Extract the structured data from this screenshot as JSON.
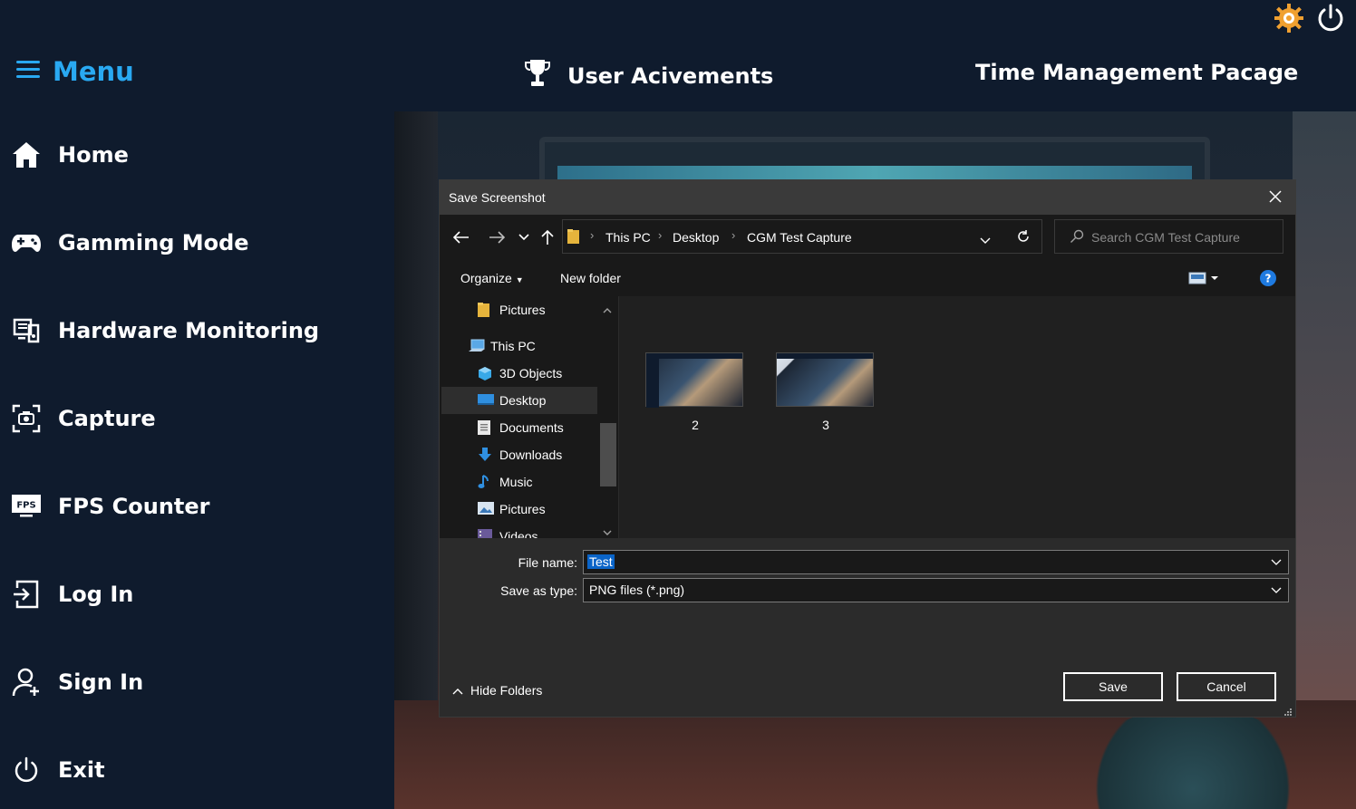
{
  "header": {
    "menu_label": "Menu",
    "achievements_label": "User Acivements",
    "time_label": "Time Management Pacage",
    "settings_icon": "gear-icon",
    "power_icon": "power-icon",
    "accent_color": "#29a9f2"
  },
  "sidebar": {
    "items": [
      {
        "label": "Home",
        "icon": "home-icon"
      },
      {
        "label": "Gamming Mode",
        "icon": "gamepad-icon"
      },
      {
        "label": "Hardware Monitoring",
        "icon": "hardware-monitor-icon"
      },
      {
        "label": "Capture",
        "icon": "capture-camera-icon"
      },
      {
        "label": "FPS Counter",
        "icon": "fps-icon"
      },
      {
        "label": "Log In",
        "icon": "login-icon"
      },
      {
        "label": "Sign In",
        "icon": "user-add-icon"
      },
      {
        "label": "Exit",
        "icon": "power-icon"
      }
    ]
  },
  "dialog": {
    "title": "Save Screenshot",
    "breadcrumb": [
      "This PC",
      "Desktop",
      "CGM Test Capture"
    ],
    "search_placeholder": "Search CGM Test Capture",
    "toolbar": {
      "organize": "Organize",
      "new_folder": "New folder"
    },
    "tree": [
      {
        "label": "Pictures",
        "icon": "folder-icon"
      },
      {
        "label": "This PC",
        "icon": "computer-icon"
      },
      {
        "label": "3D Objects",
        "icon": "cube-icon"
      },
      {
        "label": "Desktop",
        "icon": "desktop-icon",
        "selected": true
      },
      {
        "label": "Documents",
        "icon": "document-icon"
      },
      {
        "label": "Downloads",
        "icon": "download-icon"
      },
      {
        "label": "Music",
        "icon": "music-icon"
      },
      {
        "label": "Pictures",
        "icon": "pictures-icon"
      },
      {
        "label": "Videos",
        "icon": "video-icon"
      }
    ],
    "files": [
      {
        "name": "2"
      },
      {
        "name": "3"
      }
    ],
    "file_name_label": "File name:",
    "file_name_value": "Test",
    "save_type_label": "Save as type:",
    "save_type_value": "PNG files (*.png)",
    "hide_folders": "Hide Folders",
    "save_label": "Save",
    "cancel_label": "Cancel"
  }
}
